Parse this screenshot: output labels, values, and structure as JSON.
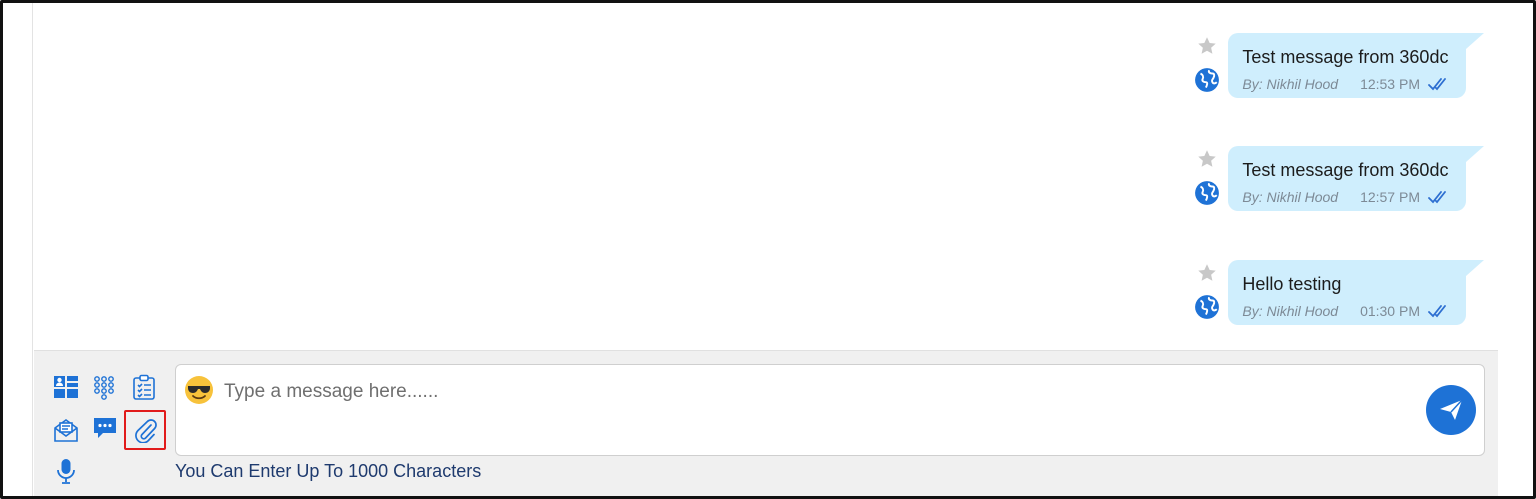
{
  "messages": [
    {
      "text": "Test message from 360dc",
      "by": "By: Nikhil Hood",
      "time": "12:53 PM"
    },
    {
      "text": "Test message from 360dc",
      "by": "By: Nikhil Hood",
      "time": "12:57 PM"
    },
    {
      "text": "Hello testing",
      "by": "By: Nikhil Hood",
      "time": "01:30 PM"
    }
  ],
  "composer": {
    "placeholder": "Type a message here......",
    "char_hint": "You Can Enter Up To 1000 Characters",
    "tools": [
      "contact-card-icon",
      "dialpad-icon",
      "clipboard-list-icon",
      "envelope-open-icon",
      "chat-bubble-icon",
      "paperclip-icon",
      "microphone-icon"
    ]
  },
  "colors": {
    "bubble": "#cfeefd",
    "accent": "#1e72d6",
    "highlight": "#e11b1b"
  }
}
